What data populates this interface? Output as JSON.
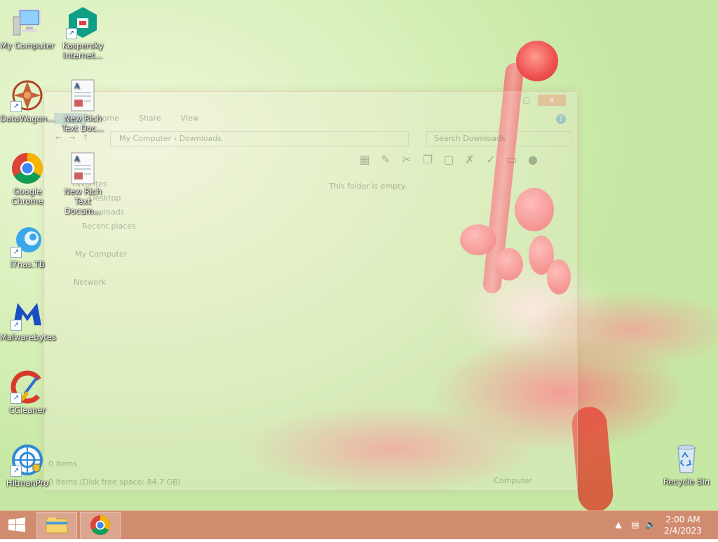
{
  "desktop": {
    "icons": [
      {
        "label_line1": "My Computer",
        "label_line2": ""
      },
      {
        "label_line1": "Kaspersky",
        "label_line2": "Internet..."
      },
      {
        "label_line1": "DataWagon...",
        "label_line2": ""
      },
      {
        "label_line1": "New Rich",
        "label_line2": "Text Doc..."
      },
      {
        "label_line1": "Google",
        "label_line2": "Chrome"
      },
      {
        "label_line1": "New Rich",
        "label_line2": "Text Docum..."
      },
      {
        "label_line1": "l7nas.TB",
        "label_line2": ""
      },
      {
        "label_line1": "Malwarebytes",
        "label_line2": ""
      },
      {
        "label_line1": "CCleaner",
        "label_line2": ""
      },
      {
        "label_line1": "HitmanPro",
        "label_line2": ""
      },
      {
        "label_line1": "Recycle Bin",
        "label_line2": ""
      }
    ]
  },
  "explorer": {
    "tabs": [
      "File",
      "Home",
      "Share",
      "View"
    ],
    "breadcrumb": [
      "My Computer",
      "Downloads"
    ],
    "search_placeholder": "Search Downloads",
    "empty_message": "This folder is empty.",
    "nav": {
      "favorites": "Favorites",
      "desktop": "Desktop",
      "downloads": "Downloads",
      "recent": "Recent places",
      "computer": "My Computer",
      "network": "Network"
    },
    "status_items": "0 items",
    "status_disk": "0 items (Disk free space: 84.7 GB)",
    "status_location": "Computer"
  },
  "taskbar": {
    "time": "2:00 AM",
    "date": "2/4/2023"
  }
}
